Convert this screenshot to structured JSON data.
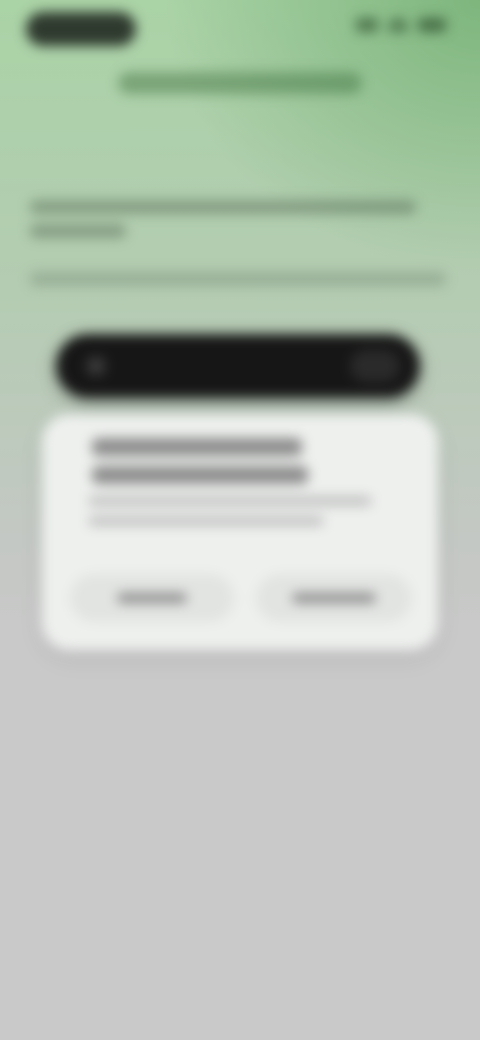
{
  "status_bar": {
    "time": "",
    "icons": [
      "cellular-signal-icon",
      "wifi-icon",
      "battery-icon"
    ]
  },
  "top_link": {
    "label": ""
  },
  "headline": {
    "text": ""
  },
  "body": {
    "paragraph_1": "",
    "paragraph_2": ""
  },
  "cta": {
    "label": ""
  },
  "card": {
    "title": "",
    "body": "",
    "secondary_label": "",
    "primary_label": ""
  },
  "colors": {
    "accent_green": "#8fc48f",
    "cta_dark": "#161616",
    "card_bg": "#eef0ee",
    "page_bg": "#c9c9c9"
  }
}
